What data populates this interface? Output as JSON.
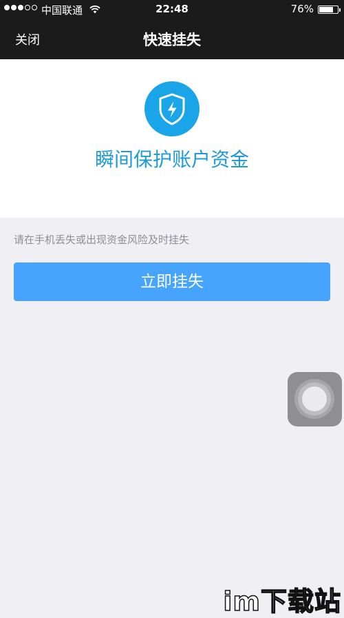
{
  "status_bar": {
    "carrier": "中国联通",
    "time": "22:48",
    "battery_percent_text": "76%",
    "battery_level": 0.76,
    "signal_strength": 3,
    "signal_max": 5
  },
  "nav": {
    "close_label": "关闭",
    "title": "快速挂失"
  },
  "hero": {
    "icon": "shield-lightning-icon",
    "slogan": "瞬间保护账户资金",
    "accent_color": "#1aa5e9"
  },
  "main": {
    "hint": "请在手机丢失或出现资金风险及时挂失",
    "button_label": "立即挂失",
    "button_color": "#46a4fc"
  },
  "watermark": {
    "text": "im下载站"
  }
}
